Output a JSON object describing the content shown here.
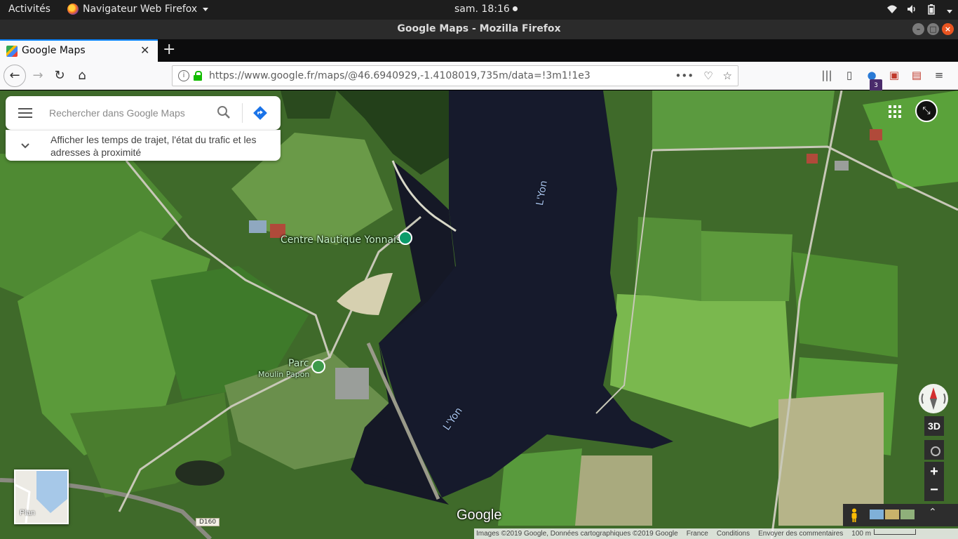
{
  "topbar": {
    "activities": "Activités",
    "app_menu": "Navigateur Web Firefox",
    "clock": "sam. 18:16",
    "tray_icons": [
      "wifi-icon",
      "volume-icon",
      "battery-icon",
      "system-menu-caret"
    ]
  },
  "window": {
    "title": "Google Maps - Mozilla Firefox"
  },
  "tabs": [
    {
      "label": "Google Maps",
      "favicon": "google-maps-favicon"
    }
  ],
  "navbar": {
    "url_domain": "https://www.google.fr",
    "url_path": "/maps/@46.6940929,-1.4108019,735m/data=!3m1!1e3",
    "toolbar_badge": "3"
  },
  "maps": {
    "search_placeholder": "Rechercher dans Google Maps",
    "info_text": "Afficher les temps de trajet, l'état du trafic et les adresses à proximité",
    "labels": {
      "centre_nautique": "Centre Nautique Yonnais",
      "parc": "Parc",
      "moulin_papon": "Moulin Papon",
      "river_upper": "L'Yon",
      "river_lower": "L'Yon",
      "road": "D160"
    },
    "controls": {
      "btn_3d": "3D",
      "zoom_in": "+",
      "zoom_out": "−",
      "plan_label": "Plan"
    },
    "logo": "Google",
    "attribution": {
      "images": "Images ©2019 Google, Données cartographiques ©2019 Google",
      "country": "France",
      "conditions": "Conditions",
      "feedback": "Envoyer des commentaires",
      "scale": "100 m"
    }
  },
  "colors": {
    "accent_tab": "#0a84ff",
    "lock_green": "#12bc00",
    "close_orange": "#e95420",
    "directions_blue": "#1a73e8"
  }
}
